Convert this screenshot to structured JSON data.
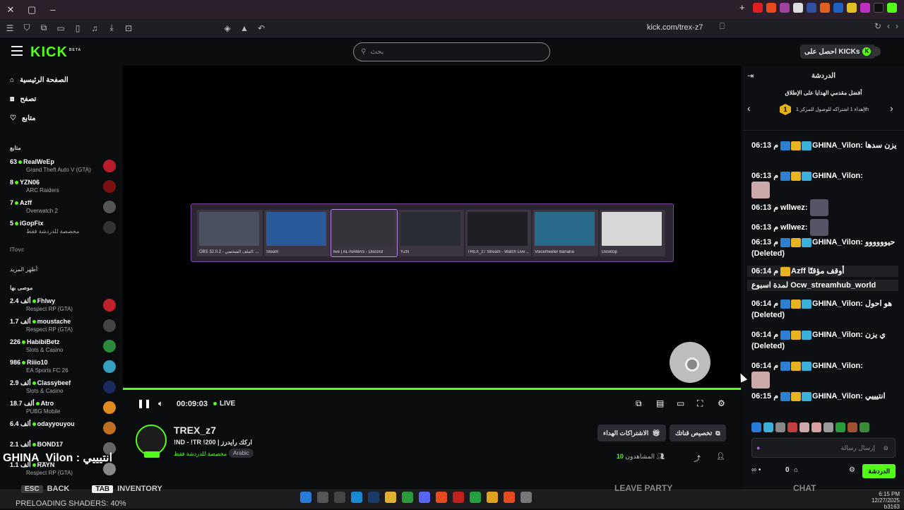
{
  "browser": {
    "url": "kick.com/trex-z7",
    "new_tab": "+",
    "close": "✕"
  },
  "topnav": {
    "logo": "KICK",
    "logo_beta": "BETA",
    "search_placeholder": "بحث",
    "kicks_label": "احصل على KICKs"
  },
  "sidebar": {
    "nav": [
      {
        "label": "الصفحة الرئيسية",
        "icon": "home-icon"
      },
      {
        "label": "تصفح",
        "icon": "browse-icon"
      },
      {
        "label": "متابع",
        "icon": "heart-icon"
      }
    ],
    "following_title": "متابع",
    "following": [
      {
        "count": "63",
        "name": "RealWeEp",
        "game": "Grand Theft Auto V (GTA)",
        "color": "#b81c2a"
      },
      {
        "count": "8",
        "name": "YZN06",
        "game": "ARC Raiders",
        "color": "#7a1010"
      },
      {
        "count": "7",
        "name": "Azff",
        "game": "Overwatch 2",
        "color": "#555555"
      },
      {
        "count": "5",
        "name": "iGopFix",
        "game": "مخصصة للدردشة فقط",
        "color": "#333333"
      }
    ],
    "offline_name": "ITovc",
    "show_more": "أظهر المزيد",
    "recommended_title": "موصى بها",
    "recommended": [
      {
        "count": "2.4 ألف",
        "name": "Fhlwy",
        "game": "Respect RP (GTA)",
        "color": "#c0202a"
      },
      {
        "count": "1.7 ألف",
        "name": "moustache",
        "game": "Respect RP (GTA)",
        "color": "#444444"
      },
      {
        "count": "226",
        "name": "HabibiBetz",
        "game": "Slots & Casino",
        "color": "#2a8a3a"
      },
      {
        "count": "986",
        "name": "Riiio10",
        "game": "EA Sports FC 26",
        "color": "#35a0c0"
      },
      {
        "count": "2.9 ألف",
        "name": "Classybeef",
        "game": "Slots & Casino",
        "color": "#1a2a5a"
      },
      {
        "count": "18.7 ألف",
        "name": "Atro",
        "game": "PUBG Mobile",
        "color": "#e08a20"
      },
      {
        "count": "6.4 ألف",
        "name": "odayyouyou",
        "game": "",
        "color": "#c07020"
      },
      {
        "count": "2.1 ألف",
        "name": "BOND17",
        "game": "",
        "color": "#666666"
      },
      {
        "count": "1.1 ألف",
        "name": "RAYN",
        "game": "Respect RP (GTA)",
        "color": "#888888"
      }
    ]
  },
  "switcher": [
    {
      "label": "OBS 32.0.2 - الملف الشخصي: ...",
      "color": "#4a5060"
    },
    {
      "label": "Steam",
      "color": "#2a5a9a"
    },
    {
      "label": "live | AL-NAMAS - Discord",
      "color": "#333338"
    },
    {
      "label": "YZN",
      "color": "#2a2d33"
    },
    {
      "label": "TREX_z7 Stream - Watch Live ...",
      "color": "#1e1e24"
    },
    {
      "label": "Voicemeeter Banana",
      "color": "#2a6a8a"
    },
    {
      "label": "Desktop",
      "color": "#d8d8d8"
    }
  ],
  "player": {
    "time": "00:09:03",
    "live": "LIVE"
  },
  "stream": {
    "name": "TREX_z7",
    "title": "!ND - !TR !200 | اركك رايدرز",
    "category": "مخصصة للدردشة فقط",
    "language": "Arabic",
    "btn_subs": "الاشتراكات الهداء",
    "btn_customize": "تخصيص قناتك",
    "viewers_label": "المشاهدون",
    "viewers": "10"
  },
  "chat": {
    "title": "الدردشة",
    "gift_title": "أفضل مقدمي الهدايا على الإطلاق",
    "gift_rank": "1",
    "gift_sub": "إهداء 1 اشتراكه للوصول للمركز 1th",
    "messages": [
      {
        "time": "06:13 م",
        "user": "GHINA_Vilon:",
        "text": "يزن سدها"
      },
      {
        "time": "06:13 م",
        "user": "GHINA_Vilon:",
        "text": ""
      },
      {
        "time": "06:13 م",
        "user": "wllwez:",
        "text": ""
      },
      {
        "time": "06:13 م",
        "user": "wllwez:",
        "text": ""
      },
      {
        "time": "06:13 م",
        "user": "GHINA_Vilon:",
        "text": "حيوووووو (Deleted)"
      },
      {
        "time": "06:14 م",
        "user": "Azff",
        "text": "أوقف مؤقتًا"
      },
      {
        "time": "",
        "user": "",
        "text": "لمدة اسبوع Ocw_streamhub_world"
      },
      {
        "time": "06:14 م",
        "user": "GHINA_Vilon:",
        "text": "هو احول (Deleted)"
      },
      {
        "time": "06:14 م",
        "user": "GHINA_Vilon:",
        "text": "ي يزن (Deleted)"
      },
      {
        "time": "06:14 م",
        "user": "GHINA_Vilon:",
        "text": ""
      },
      {
        "time": "06:15 م",
        "user": "GHINA_Vilon:",
        "text": "انتيييي"
      }
    ],
    "input_placeholder": "إرسال رسالة",
    "points": "0",
    "send": "الدردشة"
  },
  "overlay": {
    "text": "GHINA_Vilon : انتيييي"
  },
  "game_hud": {
    "esc": "ESC",
    "back": "BACK",
    "tab": "TAB",
    "inventory": "INVENTORY",
    "party": "LEAVE PARTY",
    "chat": "CHAT",
    "preload": "PRELOADING SHADERS: 40%"
  },
  "taskbar": {
    "time": "6:15 PM",
    "date": "12/27/2025",
    "build": "b3163"
  }
}
